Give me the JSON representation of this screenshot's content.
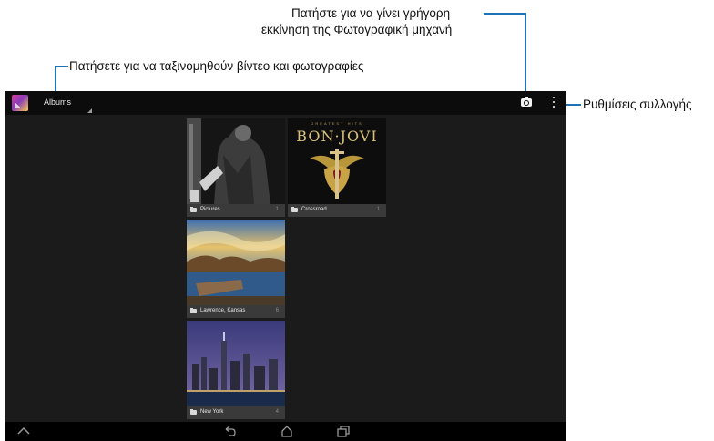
{
  "annotations": {
    "camera_line1": "Πατήστε για να γίνει γρήγορη",
    "camera_line2": "εκκίνηση της Φωτογραφική μηχανή",
    "sort": "Πατήσετε για να ταξινομηθούν βίντεο και φωτογραφίες",
    "settings": "Ρυθμίσεις συλλογής"
  },
  "actionbar": {
    "view_label": "Albums"
  },
  "albums": [
    {
      "name": "Pictures",
      "count": "1"
    },
    {
      "name": "Crossroad",
      "count": "1"
    },
    {
      "name": "Lawrence, Kansas",
      "count": "6"
    },
    {
      "name": "New York",
      "count": "4"
    }
  ],
  "album_art": {
    "top_text": "GREATEST HITS",
    "band": "BON·JOVI"
  },
  "colors": {
    "callout_line": "#1e73b8",
    "screen_bg": "#1b1b1b",
    "actionbar_bg": "#0c0c0c"
  },
  "icons": [
    "gallery-app-icon",
    "camera-icon",
    "overflow-menu-icon",
    "folder-icon",
    "collapse-icon",
    "back-icon",
    "home-icon",
    "recent-apps-icon"
  ]
}
